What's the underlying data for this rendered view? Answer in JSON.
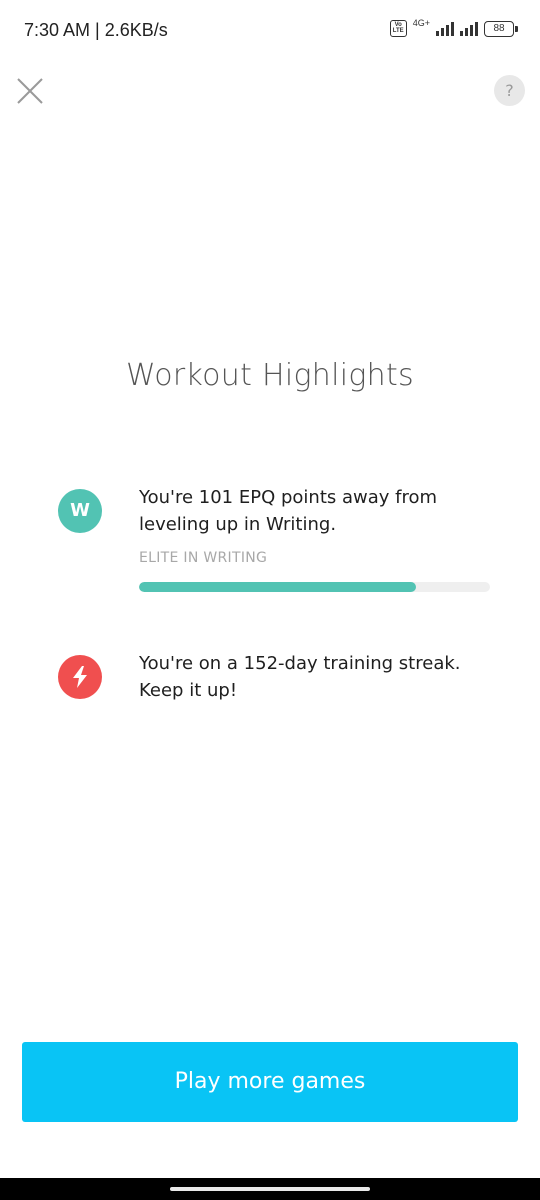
{
  "status_bar": {
    "time_speed": "7:30 AM | 2.6KB/s",
    "volte_label": "Vo LTE",
    "network_type": "4G+",
    "battery_level": "88"
  },
  "header": {
    "close_icon": "close-icon",
    "help_icon_label": "?"
  },
  "main": {
    "title": "Workout Highlights",
    "highlights": [
      {
        "badge_letter": "W",
        "badge_color": "#52c3b3",
        "text": "You're 101 EPQ points away from leveling up in Writing.",
        "subtext": "ELITE IN WRITING",
        "progress": 0.79
      },
      {
        "badge_icon": "lightning-icon",
        "badge_color": "#f04f4f",
        "text": "You're on a 152-day training streak. Keep it up!"
      }
    ]
  },
  "footer": {
    "cta_label": "Play more games",
    "cta_color": "#09c4f5"
  }
}
